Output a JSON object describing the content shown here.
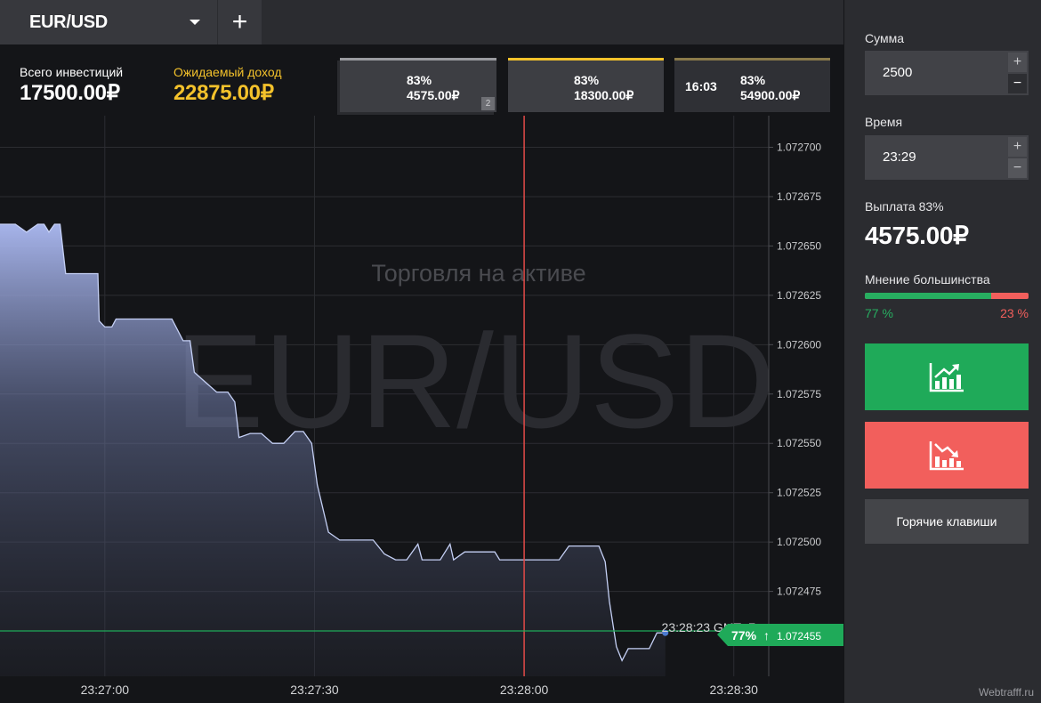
{
  "topbar": {
    "asset": "EUR/USD",
    "add_label": "+"
  },
  "stats": {
    "total_label": "Всего инвестиций",
    "total_value": "17500.00₽",
    "expected_label": "Ожидаемый доход",
    "expected_value": "22875.00₽"
  },
  "cards": [
    {
      "percent": "83%",
      "amount": "4575.00₽",
      "badge": "2"
    },
    {
      "percent": "83%",
      "amount": "18300.00₽"
    },
    {
      "time": "16:03",
      "percent": "83%",
      "amount": "54900.00₽"
    }
  ],
  "chart_header": {
    "trading_label": "Торговля на активе",
    "watermark": "EUR/USD"
  },
  "chart_data": {
    "type": "area",
    "y_ticks": [
      "1.072700",
      "1.072675",
      "1.072650",
      "1.072625",
      "1.072600",
      "1.072575",
      "1.072550",
      "1.072525",
      "1.072500",
      "1.072475"
    ],
    "ylim": [
      1.072432,
      1.072716
    ],
    "x_ticks": [
      "23:27:00",
      "23:27:30",
      "23:28:00",
      "23:28:30"
    ],
    "x_tick_seconds": [
      0,
      30,
      60,
      90
    ],
    "xlim": [
      -15,
      95
    ],
    "expiry_time": "23:28:00",
    "expiry_seconds": 60,
    "current_time_label": "23:28:23 GMT+7",
    "current_price": "1.072455",
    "current_sentiment": "77%",
    "series": [
      {
        "values": [
          [
            -15,
            1.072661
          ],
          [
            -14.4,
            1.072661
          ],
          [
            -12.8,
            1.072661
          ],
          [
            -11.2,
            1.072657
          ],
          [
            -9.6,
            1.072661
          ],
          [
            -8.7,
            1.072661
          ],
          [
            -8,
            1.072657
          ],
          [
            -7.2,
            1.072661
          ],
          [
            -6.4,
            1.072661
          ],
          [
            -5.6,
            1.072636
          ],
          [
            -2.4,
            1.072636
          ],
          [
            -1,
            1.072636
          ],
          [
            -0.8,
            1.072612
          ],
          [
            0,
            1.072609
          ],
          [
            1,
            1.072609
          ],
          [
            1.6,
            1.072613
          ],
          [
            4.8,
            1.072613
          ],
          [
            6.4,
            1.072613
          ],
          [
            8,
            1.072613
          ],
          [
            9.6,
            1.072613
          ],
          [
            11.2,
            1.072602
          ],
          [
            12.2,
            1.072602
          ],
          [
            12.8,
            1.072586
          ],
          [
            14.4,
            1.072581
          ],
          [
            16,
            1.072576
          ],
          [
            17.6,
            1.072576
          ],
          [
            18.6,
            1.072571
          ],
          [
            19.2,
            1.072553
          ],
          [
            20.8,
            1.072555
          ],
          [
            22.4,
            1.072555
          ],
          [
            24,
            1.07255
          ],
          [
            25.6,
            1.07255
          ],
          [
            27.2,
            1.072556
          ],
          [
            28.4,
            1.072556
          ],
          [
            29.6,
            1.07255
          ],
          [
            30.4,
            1.072529
          ],
          [
            32,
            1.072505
          ],
          [
            33.6,
            1.072501
          ],
          [
            36.8,
            1.072501
          ],
          [
            38.4,
            1.072501
          ],
          [
            40,
            1.072494
          ],
          [
            41.6,
            1.072491
          ],
          [
            43.2,
            1.072491
          ],
          [
            44.8,
            1.072499
          ],
          [
            45.4,
            1.072491
          ],
          [
            46.4,
            1.072491
          ],
          [
            48,
            1.072491
          ],
          [
            49.4,
            1.072499
          ],
          [
            49.9,
            1.072491
          ],
          [
            51.5,
            1.072495
          ],
          [
            53,
            1.072495
          ],
          [
            54.4,
            1.072495
          ],
          [
            55.8,
            1.072495
          ],
          [
            56.5,
            1.072491
          ],
          [
            59,
            1.072491
          ],
          [
            60.5,
            1.072491
          ],
          [
            62.5,
            1.072491
          ],
          [
            65,
            1.072491
          ],
          [
            66.4,
            1.072498
          ],
          [
            68,
            1.072498
          ],
          [
            70.7,
            1.072498
          ],
          [
            71.6,
            1.07249
          ],
          [
            72.2,
            1.07247
          ],
          [
            73.2,
            1.072447
          ],
          [
            74,
            1.07244
          ],
          [
            74.9,
            1.072446
          ],
          [
            76,
            1.072446
          ],
          [
            77.9,
            1.072446
          ],
          [
            79,
            1.072454
          ],
          [
            80.2,
            1.072454
          ]
        ]
      }
    ]
  },
  "panel": {
    "amount_label": "Сумма",
    "amount_value": "2500",
    "time_label": "Время",
    "time_value": "23:29",
    "plus": "+",
    "minus": "−",
    "payout_label": "Выплата",
    "payout_percent": "83%",
    "payout_value": "4575.00₽",
    "majority_label": "Мнение большинства",
    "majority_up": "77 %",
    "majority_down": "23 %",
    "majority_up_fraction": 0.77,
    "hotkeys_label": "Горячие клавиши",
    "up_icon": "chart-up-arrow-icon",
    "down_icon": "chart-down-arrow-icon"
  },
  "site_watermark": "Webtrafff.ru",
  "colors": {
    "up": "#1faa59",
    "down": "#f25f5c",
    "accent": "#f4c22b",
    "expiry_line": "#e24a47",
    "price_line": "#1faa59"
  }
}
